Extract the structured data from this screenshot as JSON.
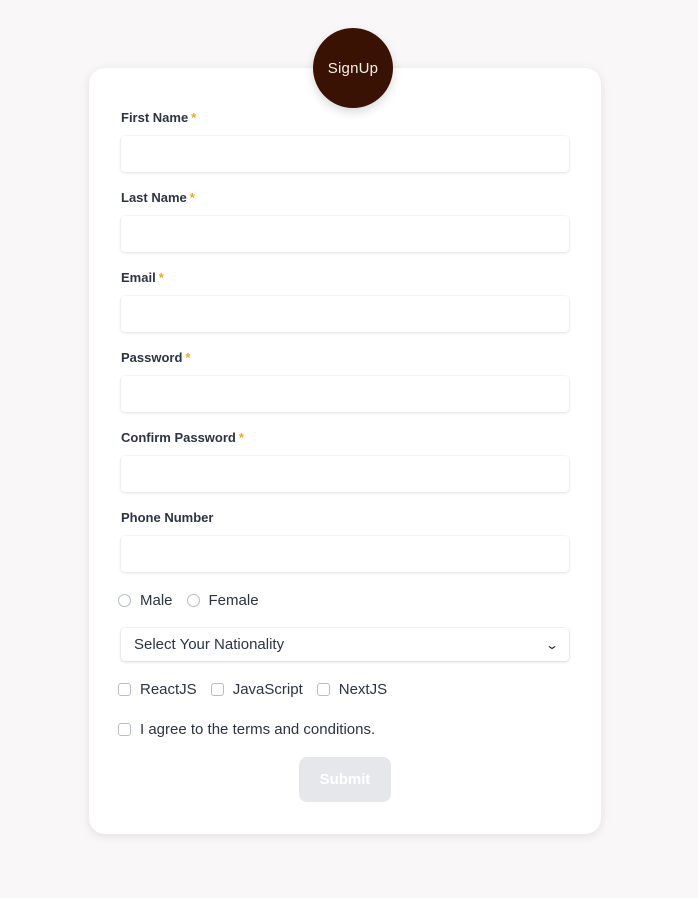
{
  "logo": {
    "text": "SignUp"
  },
  "fields": [
    {
      "label": "First Name",
      "required_mark": "*",
      "value": "",
      "placeholder": ""
    },
    {
      "label": "Last Name",
      "required_mark": "*",
      "value": "",
      "placeholder": ""
    },
    {
      "label": "Email",
      "required_mark": "*",
      "value": "",
      "placeholder": ""
    },
    {
      "label": "Password",
      "required_mark": "*",
      "value": "",
      "placeholder": ""
    },
    {
      "label": "Confirm Password",
      "required_mark": "*",
      "value": "",
      "placeholder": ""
    },
    {
      "label": "Phone Number",
      "value": "",
      "placeholder": ""
    }
  ],
  "gender": {
    "options": [
      "Male",
      "Female"
    ],
    "selected": null
  },
  "nationality": {
    "selected_text": "Select Your Nationality"
  },
  "skills": {
    "options": [
      "ReactJS",
      "JavaScript",
      "NextJS"
    ],
    "checked": []
  },
  "terms": {
    "label": "I agree to the terms and conditions.",
    "checked": false
  },
  "submit": {
    "label": "Submit",
    "disabled": true
  },
  "colors": {
    "logo_bg": "#3a1204",
    "required_mark": "#f5a623",
    "label_text": "#2b3345",
    "submit_disabled_bg": "#e5e7eb",
    "page_bg": "#f9f7f8"
  },
  "icons": {
    "select_arrow": "chevron-down-icon"
  }
}
